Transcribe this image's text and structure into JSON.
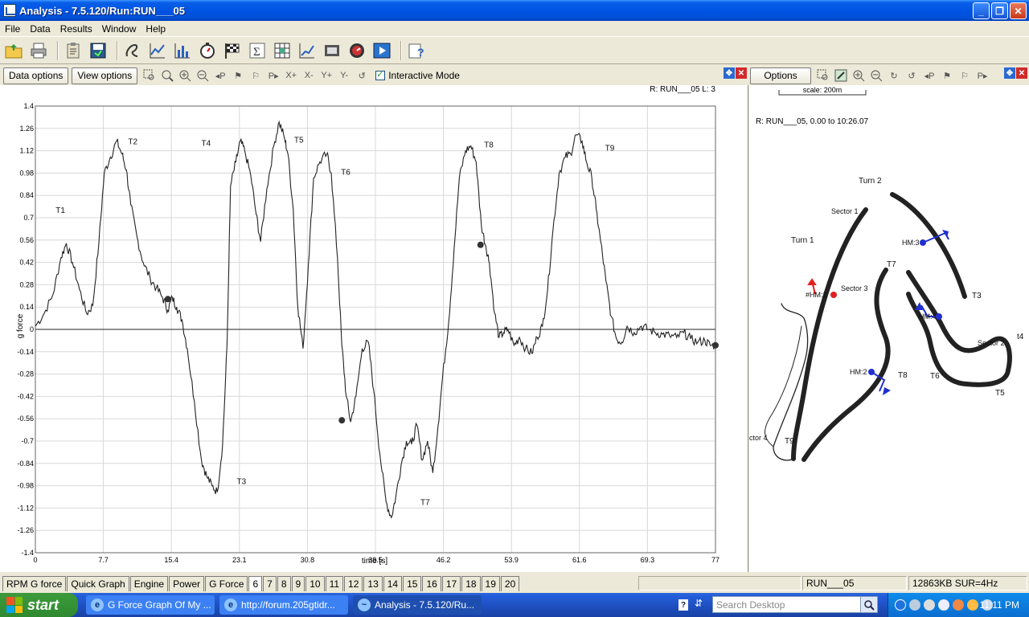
{
  "window": {
    "title": "Analysis - 7.5.120/Run:RUN___05"
  },
  "menu": [
    "File",
    "Data",
    "Results",
    "Window",
    "Help"
  ],
  "graph": {
    "data_options": "Data options",
    "view_options": "View options",
    "interactive_mode": "Interactive Mode",
    "run_label": "R: RUN___05  L: 3",
    "ylabel": "g force",
    "xlabel": "time [s]"
  },
  "chart_data": {
    "type": "line",
    "xlabel": "time [s]",
    "ylabel": "g force",
    "xlim": [
      0,
      77
    ],
    "ylim": [
      -1.4,
      1.4
    ],
    "xticks": [
      0,
      7.7,
      15.4,
      23.1,
      30.8,
      38.5,
      46.2,
      53.9,
      61.6,
      69.3,
      77
    ],
    "xtick_labels": [
      "0",
      "7.7",
      "15.4",
      "23.1",
      "30.8",
      "38.5",
      "46.2",
      "53.9",
      "61.6",
      "69.3",
      "77"
    ],
    "yticks": [
      1.4,
      1.26,
      1.12,
      0.98,
      0.84,
      0.7,
      0.56,
      0.42,
      0.28,
      0.14,
      0,
      -0.14,
      -0.28,
      -0.42,
      -0.56,
      -0.7,
      -0.84,
      -0.98,
      -1.12,
      -1.26,
      -1.4
    ],
    "ytick_labels": [
      "1.4",
      "1.26",
      "1.12",
      "0.98",
      "0.84",
      "0.7",
      "0.56",
      "0.42",
      "0.28",
      "0.14",
      "0",
      "-0.14",
      "-0.28",
      "-0.42",
      "-0.56",
      "-0.7",
      "-0.84",
      "-0.98",
      "-1.12",
      "-1.26",
      "-1.4"
    ],
    "grid": true,
    "series": [
      {
        "x": [
          0,
          1,
          2,
          2.9,
          3.5,
          4.2,
          5,
          5.8,
          6.5,
          7.2,
          7.8,
          8.5,
          9.2,
          9.8,
          10.3,
          10.8,
          11.5,
          12.2,
          13,
          13.7,
          14.4,
          15,
          15.5,
          16,
          16.6,
          17.2,
          18,
          18.8,
          19.4,
          20,
          20.6,
          21.2,
          21.7,
          22.1,
          22.7,
          23.2,
          23.7,
          24.4,
          25,
          25.5,
          26.2,
          27,
          27.6,
          28.2,
          28.6,
          29.2,
          29.7,
          30.3,
          30.9,
          31.5,
          32.2,
          33,
          33.5,
          34.2,
          34.7,
          35.2,
          35.7,
          36.3,
          37,
          37.7,
          38.3,
          39,
          39.7,
          40.3,
          40.8,
          41.4,
          42,
          42.6,
          43.2,
          43.8,
          44.4,
          45,
          45.6,
          46.1,
          46.8,
          47.4,
          48,
          48.7,
          49.3,
          49.9,
          50.5,
          51,
          51.4,
          52,
          52.5,
          53,
          53.5,
          54.2,
          54.8,
          55.5,
          56.2,
          56.8,
          57.4,
          58,
          58.6,
          59.3,
          60,
          60.6,
          61.2,
          61.9,
          62.4,
          63,
          63.5,
          64,
          64.6,
          65.2,
          65.8,
          66.4,
          67,
          67.8,
          68.6,
          69.4,
          70.2,
          71,
          71.8,
          72.6,
          73.4,
          74.2,
          75,
          75.8,
          76.4,
          77
        ],
        "y": [
          0.02,
          0.1,
          0.22,
          0.45,
          0.54,
          0.42,
          0.25,
          0.1,
          0.15,
          0.55,
          0.98,
          1.08,
          1.18,
          1.1,
          1.0,
          0.78,
          0.58,
          0.42,
          0.32,
          0.26,
          0.2,
          0.12,
          0.2,
          0.14,
          0.06,
          -0.12,
          -0.45,
          -0.82,
          -0.92,
          -0.98,
          -1.02,
          -0.72,
          -0.1,
          0.9,
          1.05,
          1.18,
          1.12,
          0.96,
          0.72,
          0.55,
          0.88,
          1.15,
          1.3,
          1.2,
          1.1,
          0.75,
          0.15,
          -0.12,
          0.4,
          0.95,
          1.05,
          1.1,
          0.98,
          0.45,
          -0.1,
          -0.42,
          -0.58,
          -0.42,
          -0.12,
          -0.08,
          -0.38,
          -0.78,
          -1.08,
          -1.18,
          -1.05,
          -0.85,
          -0.7,
          -0.72,
          -0.6,
          -0.82,
          -0.7,
          -0.9,
          -0.6,
          -0.3,
          0.05,
          0.5,
          0.95,
          1.12,
          1.15,
          1.05,
          0.65,
          0.52,
          0.42,
          0.1,
          -0.05,
          -0.02,
          0.0,
          -0.1,
          -0.05,
          -0.12,
          -0.15,
          -0.05,
          0.02,
          0.25,
          0.62,
          0.98,
          1.08,
          1.1,
          1.22,
          1.18,
          1.05,
          0.95,
          0.75,
          0.55,
          0.3,
          0.08,
          -0.06,
          -0.08,
          0.02,
          -0.02,
          0.02,
          0.0,
          -0.02,
          -0.03,
          -0.04,
          -0.05,
          -0.02,
          -0.06,
          -0.08,
          -0.07,
          -0.1,
          -0.1
        ]
      }
    ],
    "markers": [
      {
        "x": 15.0,
        "y": 0.19
      },
      {
        "x": 34.7,
        "y": -0.57
      },
      {
        "x": 50.4,
        "y": 0.53
      },
      {
        "x": 77,
        "y": -0.1
      }
    ],
    "annotations": [
      {
        "text": "T1",
        "x": 2.3,
        "y": 0.73
      },
      {
        "text": "T2",
        "x": 10.5,
        "y": 1.16
      },
      {
        "text": "T4",
        "x": 18.8,
        "y": 1.15
      },
      {
        "text": "T5",
        "x": 29.3,
        "y": 1.17
      },
      {
        "text": "T6",
        "x": 34.6,
        "y": 0.97
      },
      {
        "text": "T3",
        "x": 22.8,
        "y": -0.97
      },
      {
        "text": "T7",
        "x": 43.6,
        "y": -1.1
      },
      {
        "text": "T8",
        "x": 50.8,
        "y": 1.14
      },
      {
        "text": "T9",
        "x": 64.5,
        "y": 1.12
      }
    ]
  },
  "map": {
    "options": "Options",
    "scale": "scale: 200m",
    "run_info": "R:  RUN___05, 0.00 to 10:26.07",
    "labels": [
      {
        "text": "Turn 2"
      },
      {
        "text": "Sector 1"
      },
      {
        "text": "Turn 1"
      },
      {
        "text": "HM:3"
      },
      {
        "text": "T7"
      },
      {
        "text": "Sector 3"
      },
      {
        "text": "#HM:1"
      },
      {
        "text": "HM:4"
      },
      {
        "text": "T3"
      },
      {
        "text": "t4"
      },
      {
        "text": "Sector 2"
      },
      {
        "text": "HM:2"
      },
      {
        "text": "T8"
      },
      {
        "text": "T6"
      },
      {
        "text": "T5"
      },
      {
        "text": "ctor 4"
      },
      {
        "text": "T9"
      }
    ]
  },
  "tabs": [
    "RPM G force",
    "Quick Graph",
    "Engine",
    "Power",
    "G Force",
    "6",
    "7",
    "8",
    "9",
    "10",
    "11",
    "12",
    "13",
    "14",
    "15",
    "16",
    "17",
    "18",
    "19",
    "20"
  ],
  "status": {
    "run": "RUN___05",
    "info": "12863KB SUR=4Hz"
  },
  "taskbar": {
    "start": "start",
    "items": [
      "G Force Graph Of My ...",
      "http://forum.205gtidr...",
      "Analysis - 7.5.120/Ru..."
    ],
    "search_placeholder": "Search Desktop",
    "clock": "11:11 PM"
  }
}
